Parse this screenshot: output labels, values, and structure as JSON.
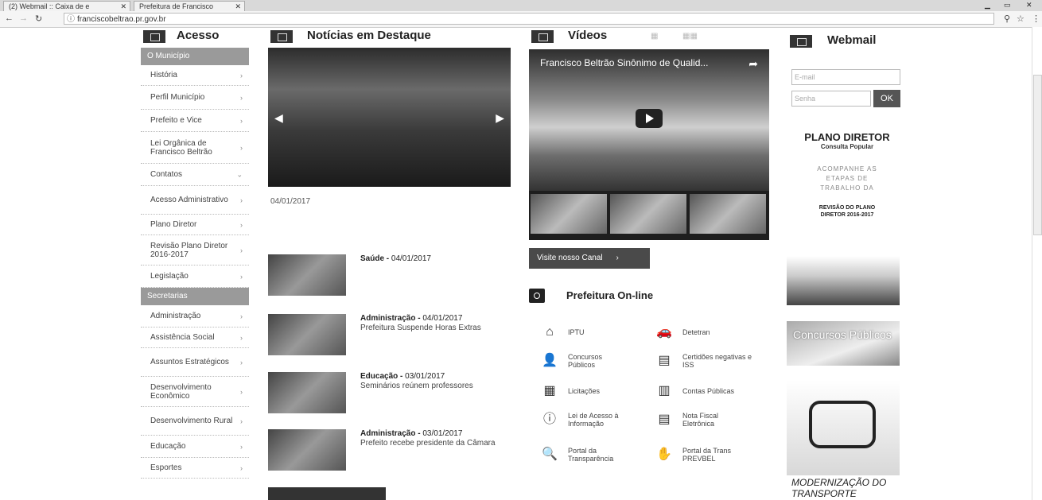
{
  "browser": {
    "tabs": [
      {
        "label": "(2) Webmail :: Caixa de e"
      },
      {
        "label": "Prefeitura de Francisco"
      }
    ],
    "url": "franciscobeltrao.pr.gov.br"
  },
  "sections": {
    "acesso": "Acesso",
    "noticias": "Notícias em Destaque",
    "videos": "Vídeos",
    "webmail": "Webmail"
  },
  "menu": {
    "group1": "O Município",
    "items1": [
      "História",
      "Perfil Município",
      "Prefeito e Vice",
      "Lei Orgânica de Francisco Beltrão",
      "Contatos",
      "Acesso Administrativo",
      "Plano Diretor",
      "Revisão Plano Diretor 2016-2017",
      "Legislação"
    ],
    "group2": "Secretarias",
    "items2": [
      "Administração",
      "Assistência Social",
      "Assuntos Estratégicos",
      "Desenvolvimento Econômico",
      "Desenvolvimento Rural",
      "Educação",
      "Esportes"
    ]
  },
  "news": {
    "main_date": "04/01/2017",
    "items": [
      {
        "category": "Saúde",
        "date": "04/01/2017",
        "text": ""
      },
      {
        "category": "Administração",
        "date": "04/01/2017",
        "text": "Prefeitura Suspende Horas Extras"
      },
      {
        "category": "Educação",
        "date": "03/01/2017",
        "text": "Seminários reúnem professores"
      },
      {
        "category": "Administração",
        "date": "03/01/2017",
        "text": "Prefeito recebe presidente da Câmara"
      }
    ]
  },
  "videos": {
    "title": "Francisco Beltrão Sinônimo de Qualid...",
    "visit_button": "Visite nosso Canal"
  },
  "online": {
    "title": "Prefeitura On-line",
    "services": [
      {
        "label": "IPTU",
        "icon": "house-icon"
      },
      {
        "label": "Detetran",
        "icon": "car-icon"
      },
      {
        "label": "Concursos Públicos",
        "icon": "user-icon"
      },
      {
        "label": "Certidões negativas e ISS",
        "icon": "document-icon"
      },
      {
        "label": "Licitações",
        "icon": "grid-icon"
      },
      {
        "label": "Contas Públicas",
        "icon": "calculator-icon"
      },
      {
        "label": "Lei de Acesso à Informação",
        "icon": "info-icon"
      },
      {
        "label": "Nota Fiscal Eletrônica",
        "icon": "invoice-icon"
      },
      {
        "label": "Portal da Transparência",
        "icon": "search-icon"
      },
      {
        "label": "Portal da Trans PREVBEL",
        "icon": "handshake-icon"
      }
    ]
  },
  "webmail": {
    "email_placeholder": "E-mail",
    "password_placeholder": "Senha",
    "ok": "OK"
  },
  "plano": {
    "title": "PLANO DIRETOR",
    "subtitle": "Consulta Popular",
    "line": "ACOMPANHE AS ETAPAS DE TRABALHO DA",
    "revisao": "REVISÃO DO PLANO DIRETOR 2016-2017"
  },
  "banners": {
    "concursos": "Concursos Públicos",
    "transporte": "MODERNIZAÇÃO DO TRANSPORTE"
  }
}
